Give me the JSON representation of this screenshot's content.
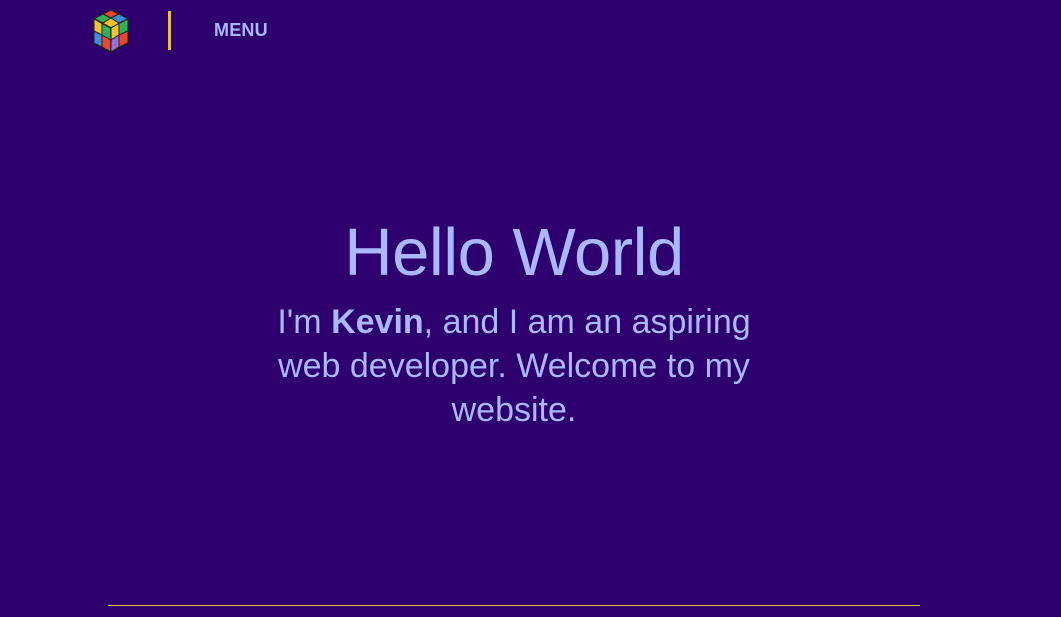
{
  "colors": {
    "background": "#2d006e",
    "text": "#a9b8ff",
    "accent_line": "#e6c13a"
  },
  "header": {
    "logo_icon": "cube-logo",
    "menu_label": "MENU"
  },
  "hero": {
    "title": "Hello World",
    "intro_prefix": "I'm ",
    "name": "Kevin",
    "intro_suffix": ", and I am an aspiring web developer. Welcome to my website."
  }
}
